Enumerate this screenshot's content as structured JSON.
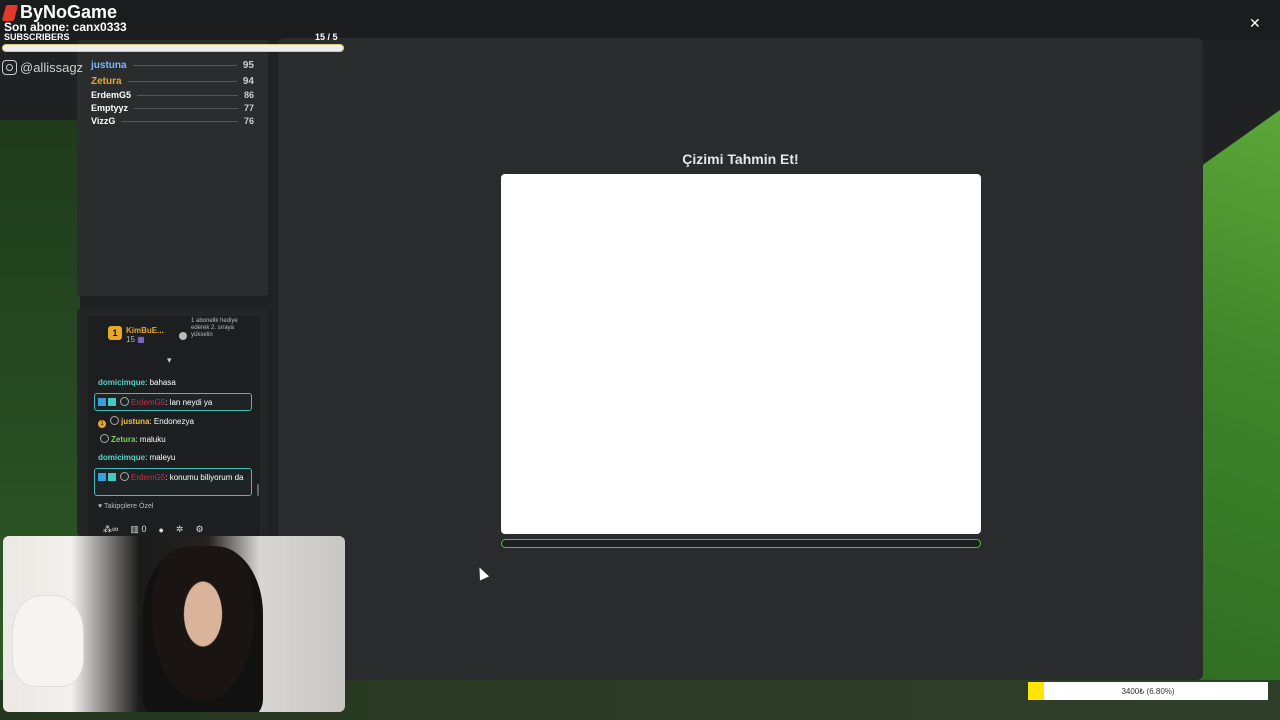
{
  "brand": {
    "name": "ByNoGame"
  },
  "subscribers": {
    "last_sub": "Son abone: canx0333",
    "label": "SUBSCRIBERS",
    "count": "15  / 5"
  },
  "social": {
    "handle": "@allissagz"
  },
  "leaderboard": [
    {
      "name": "justuna",
      "score": "95",
      "color": "#7ab8ff"
    },
    {
      "name": "Zetura",
      "score": "94",
      "color": "#e8a72a"
    },
    {
      "name": "ErdemG5",
      "score": "86",
      "color": "#ffffff"
    },
    {
      "name": "Emptyyz",
      "score": "77",
      "color": "#ffffff"
    },
    {
      "name": "VizzG",
      "score": "76",
      "color": "#ffffff"
    }
  ],
  "chat": {
    "top_gifter": {
      "rank": "1",
      "name": "KimBuE...",
      "count": "15"
    },
    "gift_promo": "1 abonelik hediye ederek 2. sıraya yükselin",
    "messages": [
      {
        "user": "domicimque",
        "text": "bahasa"
      },
      {
        "user": "ErdemG5",
        "text": "lan neydi ya"
      },
      {
        "user": "justuna",
        "text": "Endonezya"
      },
      {
        "user": "Zetura",
        "text": "maluku"
      },
      {
        "user": "domicimque",
        "text": "maleyu"
      },
      {
        "user": "ErdemG5",
        "text": "konumu biliyorum da"
      }
    ],
    "followers_only": "Takipçilere Özel",
    "tools": {
      "infinity": "∞",
      "shop_count": "0"
    }
  },
  "game": {
    "title": "Çizimi Tahmin Et!",
    "timer_fraction": 0
  },
  "goal": {
    "text": "3400₺ (6.80%)",
    "progress_percent": 6.8
  },
  "colors": {
    "accent_green": "#4cbf3a",
    "goal_yellow": "#ffe600"
  }
}
